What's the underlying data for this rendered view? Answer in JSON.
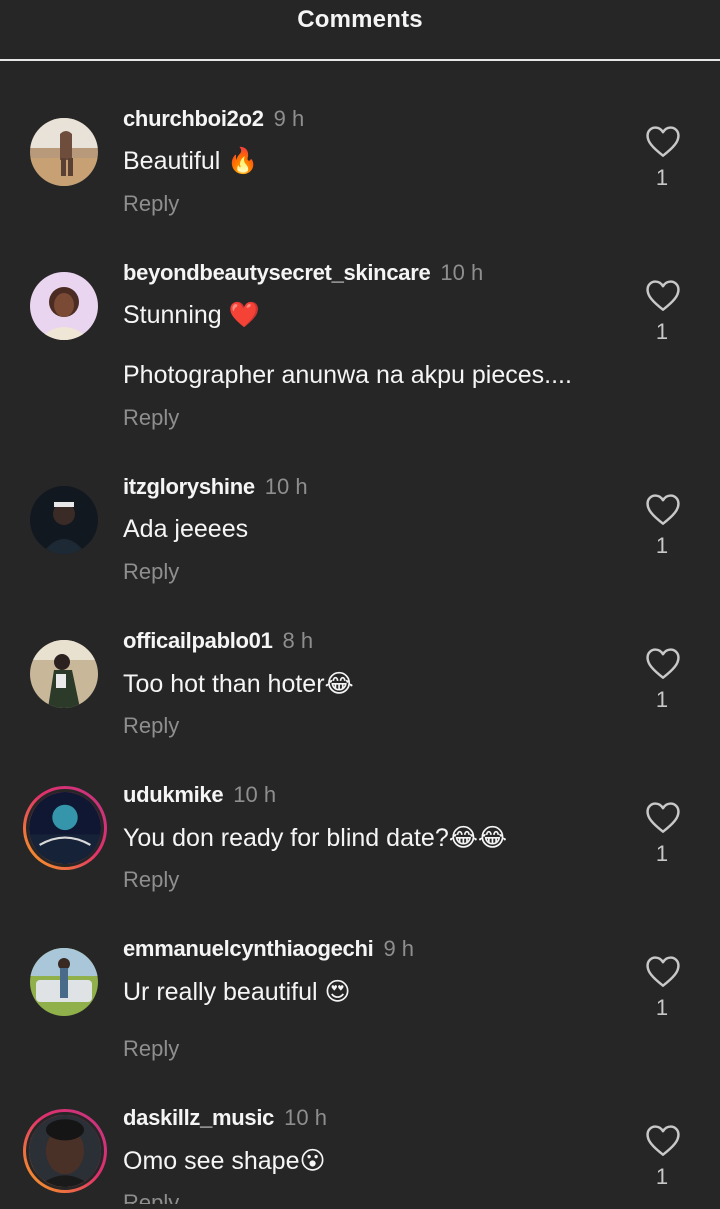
{
  "header": {
    "title": "Comments"
  },
  "comments": [
    {
      "username": "churchboi2o2",
      "time": "9 h",
      "text": "Beautiful 🔥",
      "extra": "",
      "reply": "Reply",
      "likes": "1",
      "story_ring": false
    },
    {
      "username": "beyondbeautysecret_skincare",
      "time": "10 h",
      "text": "Stunning ❤️",
      "extra": "Photographer anunwa na akpu pieces....",
      "reply": "Reply",
      "likes": "1",
      "story_ring": false
    },
    {
      "username": "itzgloryshine",
      "time": "10 h",
      "text": "Ada jeeees",
      "extra": "",
      "reply": "Reply",
      "likes": "1",
      "story_ring": false
    },
    {
      "username": "officailpablo01",
      "time": "8 h",
      "text": "Too hot than hoter😂",
      "extra": "",
      "reply": "Reply",
      "likes": "1",
      "story_ring": false
    },
    {
      "username": "udukmike",
      "time": "10 h",
      "text": "You don ready for blind date?😂😂",
      "extra": "",
      "reply": "Reply",
      "likes": "1",
      "story_ring": true
    },
    {
      "username": "emmanuelcynthiaogechi",
      "time": "9 h",
      "text": "Ur really beautiful 😍",
      "extra": "",
      "reply": "Reply",
      "likes": "1",
      "story_ring": false
    },
    {
      "username": "daskillz_music",
      "time": "10 h",
      "text": "Omo see shape😮",
      "extra": "",
      "reply": "Reply",
      "likes": "1",
      "story_ring": true
    }
  ],
  "icons": {
    "like": "heart-outline-icon"
  },
  "colors": {
    "background": "#262626",
    "muted": "#8e8e8e",
    "text": "#f5f5f5",
    "story_ring_start": "#f9a61c",
    "story_ring_end": "#c13584"
  }
}
